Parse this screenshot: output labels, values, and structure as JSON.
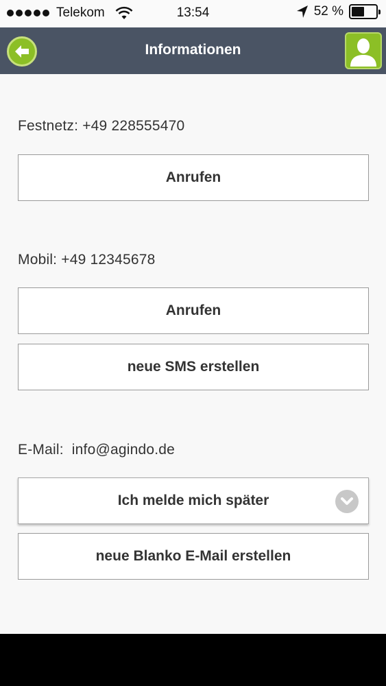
{
  "status_bar": {
    "carrier": "Telekom",
    "time": "13:54",
    "battery_percent": "52 %",
    "battery_level": 0.52,
    "signal_icon": "signal-dots-icon",
    "wifi_icon": "wifi-icon",
    "location_icon": "location-arrow-icon",
    "battery_icon": "battery-icon"
  },
  "navbar": {
    "title": "Informationen",
    "back_icon": "back-arrow-icon",
    "profile_icon": "user-profile-icon",
    "bar_color": "#4a5464",
    "accent_color": "#8cbf26"
  },
  "landline": {
    "label": "Festnetz: +49 228555470",
    "call_button": "Anrufen"
  },
  "mobile": {
    "label": "Mobil: +49 12345678",
    "call_button": "Anrufen",
    "sms_button": "neue SMS erstellen"
  },
  "email": {
    "label": "E-Mail:  info@agindo.de",
    "select_value": "Ich melde mich später",
    "select_icon": "chevron-down-icon",
    "blank_mail_button": "neue Blanko E-Mail erstellen"
  }
}
